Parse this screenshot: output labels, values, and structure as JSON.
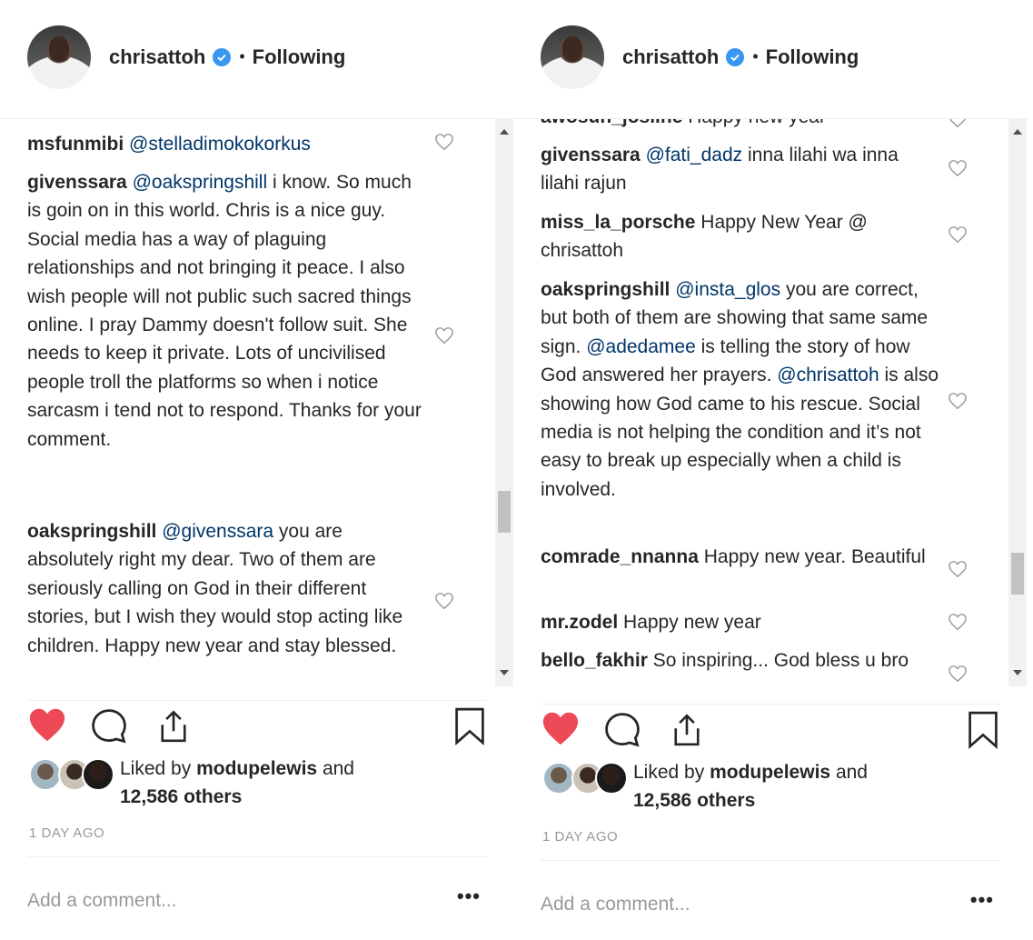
{
  "colors": {
    "accent": "#3897f0",
    "like": "#ed4956",
    "mention": "#003569",
    "muted": "#999999"
  },
  "left": {
    "header": {
      "handle": "chrisattoh",
      "separator": "•",
      "follow": "Following"
    },
    "comments": [
      {
        "user": "msfunmibi",
        "parts": [
          {
            "t": "@stelladimokokorkus",
            "m": true
          }
        ]
      },
      {
        "user": "givenssara",
        "parts": [
          {
            "t": "@oakspringshill",
            "m": true
          },
          {
            "t": " i know. So much is goin on in this world. Chris is a nice guy. Social media has a way of plaguing relationships and not bringing it peace. I also wish people will not public such sacred things online. I pray Dammy doesn't follow suit. She needs to keep it private. Lots of uncivilised people troll the platforms so when i notice sarcasm i tend not to respond. Thanks for your comment.",
            "m": false
          }
        ]
      },
      {
        "user": "oakspringshill",
        "parts": [
          {
            "t": "@givenssara",
            "m": true
          },
          {
            "t": " you are absolutely right my dear. Two of them are seriously calling on God in their different stories, but I wish they would stop acting like children. Happy new year and stay blessed.",
            "m": false
          }
        ]
      }
    ],
    "likes": {
      "prefix": "Liked by",
      "user": "modupelewis",
      "suffix": "and",
      "others": "12,586 others"
    },
    "time": "1 DAY AGO",
    "add_comment": "Add a comment...",
    "more": "•••",
    "scroll_fraction": 0.7
  },
  "right": {
    "header": {
      "handle": "chrisattoh",
      "separator": "•",
      "follow": "Following"
    },
    "comments": [
      {
        "user": "awosun_josline",
        "parts": [
          {
            "t": " Happy new year",
            "m": false
          }
        ]
      },
      {
        "user": "givenssara",
        "parts": [
          {
            "t": "@fati_dadz",
            "m": true
          },
          {
            "t": " inna lilahi wa inna lilahi rajun",
            "m": false
          }
        ]
      },
      {
        "user": "miss_la_porsche",
        "parts": [
          {
            "t": " Happy New Year @ chrisattoh",
            "m": false
          }
        ]
      },
      {
        "user": "oakspringshill",
        "parts": [
          {
            "t": "@insta_glos",
            "m": true
          },
          {
            "t": " you are correct, but both of them are showing that same same sign. ",
            "m": false
          },
          {
            "t": "@adedamee",
            "m": true
          },
          {
            "t": " is telling the story of how God answered her prayers. ",
            "m": false
          },
          {
            "t": "@chrisattoh",
            "m": true
          },
          {
            "t": " is also showing how God came to his rescue. Social media is not helping the condition and it’s not easy to break up especially when a child is involved.",
            "m": false
          }
        ]
      },
      {
        "user": "comrade_nnanna",
        "parts": [
          {
            "t": " Happy new year. Beautiful",
            "m": false
          }
        ]
      },
      {
        "user": "mr.zodel",
        "parts": [
          {
            "t": " Happy new year",
            "m": false
          }
        ]
      },
      {
        "user": "bello_fakhir",
        "parts": [
          {
            "t": " So inspiring... God bless u bro",
            "m": false
          }
        ]
      }
    ],
    "likes": {
      "prefix": "Liked by",
      "user": "modupelewis",
      "suffix": "and",
      "others": "12,586 others"
    },
    "time": "1 DAY AGO",
    "add_comment": "Add a comment...",
    "more": "•••",
    "scroll_fraction": 0.85
  }
}
